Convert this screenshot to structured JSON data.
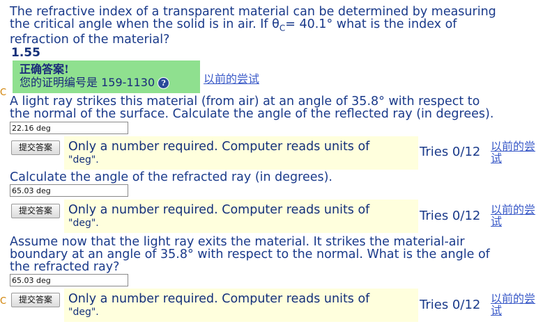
{
  "q1": {
    "lines": [
      "The refractive index of a transparent material can be determined by measuring",
      "the critical angle when the solid is in air. If θ",
      "refraction of the material?"
    ],
    "line2_sub": "C",
    "line2_rest": "= 40.1° what is the index of",
    "answer": "1.55"
  },
  "correct": {
    "title": "正确答案!",
    "id_label": "您的证明编号是",
    "id_code": "159-1130",
    "help_icon": "?"
  },
  "prev_attempts_label": "以前的尝试",
  "q2": {
    "lines": [
      "A light ray strikes this material (from air) at an angle of 35.8° with respect to",
      "the normal of the surface. Calculate the angle of the reflected ray (in degrees)."
    ],
    "input_value": "22.16 deg"
  },
  "q3": {
    "lines": [
      "Calculate the angle of the refracted ray (in degrees)."
    ],
    "input_value": "65.03 deg"
  },
  "q4": {
    "lines": [
      "Assume now that the light ray exits the material. It strikes the material-air",
      "boundary at an angle of 35.8° with respect to the normal. What is the angle of",
      "the refracted ray?"
    ],
    "input_value": "65.03 deg"
  },
  "submit_label": "提交答案",
  "hint": {
    "text": "Only a number required. Computer reads units of",
    "unit": "\"deg\"."
  },
  "tries_label": "Tries 0/12",
  "prev_label_line1": "以前的尝",
  "prev_label_line2": "试"
}
